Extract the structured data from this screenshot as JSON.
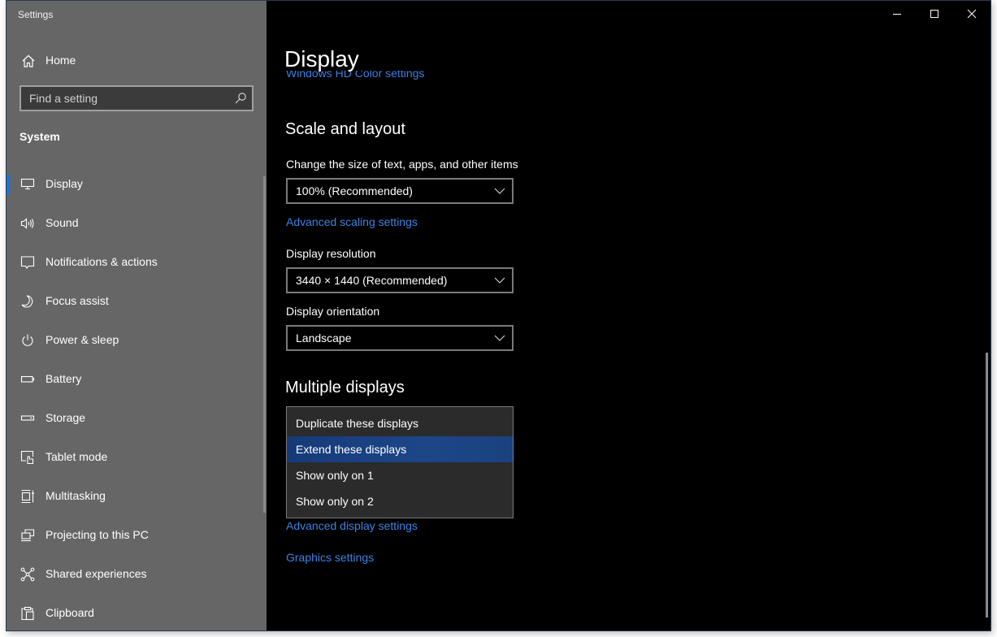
{
  "window": {
    "app_title": "Settings",
    "caption": {
      "minimize": "minimize",
      "maximize": "maximize",
      "close": "close"
    }
  },
  "sidebar": {
    "home_label": "Home",
    "search": {
      "placeholder": "Find a setting",
      "value": ""
    },
    "section_label": "System",
    "active_index": 0,
    "items": [
      {
        "label": "Display",
        "icon": "monitor-icon"
      },
      {
        "label": "Sound",
        "icon": "speaker-icon"
      },
      {
        "label": "Notifications & actions",
        "icon": "notification-icon"
      },
      {
        "label": "Focus assist",
        "icon": "moon-icon"
      },
      {
        "label": "Power & sleep",
        "icon": "power-icon"
      },
      {
        "label": "Battery",
        "icon": "battery-icon"
      },
      {
        "label": "Storage",
        "icon": "storage-icon"
      },
      {
        "label": "Tablet mode",
        "icon": "tablet-mode-icon"
      },
      {
        "label": "Multitasking",
        "icon": "multitasking-icon"
      },
      {
        "label": "Projecting to this PC",
        "icon": "projecting-icon"
      },
      {
        "label": "Shared experiences",
        "icon": "shared-experiences-icon"
      },
      {
        "label": "Clipboard",
        "icon": "clipboard-icon"
      }
    ]
  },
  "main": {
    "page_title": "Display",
    "hd_color_link": "Windows HD Color settings",
    "scale_section": {
      "heading": "Scale and layout",
      "size_label": "Change the size of text, apps, and other items",
      "size_value": "100% (Recommended)",
      "advanced_scaling_link": "Advanced scaling settings",
      "resolution_label": "Display resolution",
      "resolution_value": "3440 × 1440 (Recommended)",
      "orientation_label": "Display orientation",
      "orientation_value": "Landscape"
    },
    "multiple_displays": {
      "heading": "Multiple displays",
      "options": [
        "Duplicate these displays",
        "Extend these displays",
        "Show only on 1",
        "Show only on 2"
      ],
      "selected_index": 1
    },
    "advanced_display_link": "Advanced display settings",
    "graphics_link": "Graphics settings"
  },
  "colors": {
    "accent": "#1f6fdb",
    "link": "#3d82e6",
    "sidebar_bg": "#666666",
    "main_bg": "#000000",
    "dropdown_selected": "#1d4688"
  }
}
